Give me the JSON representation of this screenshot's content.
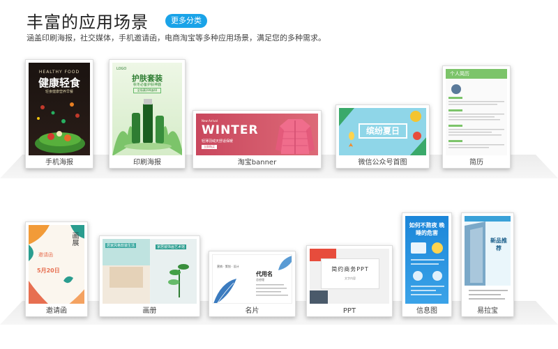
{
  "header": {
    "title": "丰富的应用场景",
    "more_label": "更多分类",
    "subtitle": "涵盖印刷海报，社交媒体，手机邀请函，电商淘宝等多种应用场景，满足您的多种需求。"
  },
  "row1": [
    {
      "label": "手机海报",
      "thumb": {
        "top": "HEALTHY FOOD",
        "title": "健康轻食",
        "sub": "轻食健康营养早餐"
      }
    },
    {
      "label": "印刷海报",
      "thumb": {
        "logo": "LOGO",
        "title": "护肤套装",
        "sub": "秋冬必备护肤神器",
        "tag": "全场满199减40"
      }
    },
    {
      "label": "淘宝banner",
      "thumb": {
        "small": "New Arrival",
        "title": "WINTER",
        "sub": "轻薄羽绒天舒适保暖",
        "btn": "立即购买"
      }
    },
    {
      "label": "微信公众号首图",
      "thumb": {
        "title": "缤纷夏日"
      }
    },
    {
      "label": "简历",
      "thumb": {
        "title": "个人简历"
      }
    }
  ],
  "row2": [
    {
      "label": "邀请函",
      "thumb": {
        "title": "画展",
        "sub": "邀请函",
        "date": "5月20日"
      }
    },
    {
      "label": "画册",
      "thumb": {
        "left": "居家风格软装生活",
        "right": "家居装饰画艺术馆"
      }
    },
    {
      "label": "名片",
      "thumb": {
        "name": "代用名",
        "role": "总经理",
        "left": "营销 · 策划 · 设计"
      }
    },
    {
      "label": "PPT",
      "thumb": {
        "title": "简约商务PPT",
        "sub": "文字内容"
      }
    },
    {
      "label": "信息图",
      "thumb": {
        "title": "如何不熬夜 晚睡的危害"
      }
    },
    {
      "label": "易拉宝",
      "thumb": {
        "title": "新品推荐"
      }
    }
  ],
  "colors": {
    "accent": "#1aa3e8"
  }
}
